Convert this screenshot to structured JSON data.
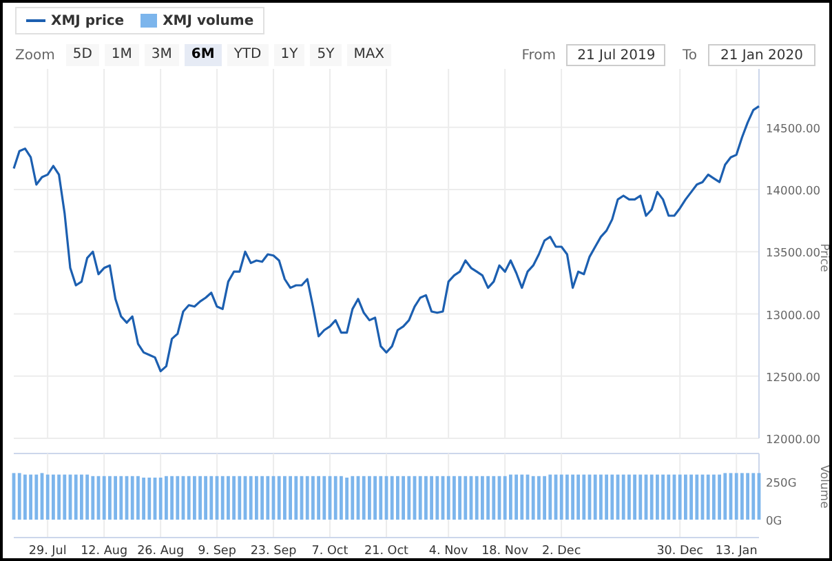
{
  "zoom": {
    "label": "Zoom",
    "buttons": [
      {
        "label": "5D",
        "selected": false
      },
      {
        "label": "1M",
        "selected": false
      },
      {
        "label": "3M",
        "selected": false
      },
      {
        "label": "6M",
        "selected": true
      },
      {
        "label": "YTD",
        "selected": false
      },
      {
        "label": "1Y",
        "selected": false
      },
      {
        "label": "5Y",
        "selected": false
      },
      {
        "label": "MAX",
        "selected": false
      }
    ]
  },
  "range": {
    "from_label": "From",
    "from": "21 Jul 2019",
    "to_label": "To",
    "to": "21 Jan 2020"
  },
  "price_panel": {
    "chart_data": {
      "type": "line",
      "ylabel": "Price",
      "grid": true,
      "ylim": [
        12000,
        14970
      ],
      "yticks": [
        {
          "value": 12000,
          "label": "12000.00"
        },
        {
          "value": 12500,
          "label": "12500.00"
        },
        {
          "value": 13000,
          "label": "13000.00"
        },
        {
          "value": 13500,
          "label": "13500.00"
        },
        {
          "value": 14000,
          "label": "14000.00"
        },
        {
          "value": 14500,
          "label": "14500.00"
        }
      ],
      "categories": [
        null,
        null,
        null,
        null,
        null,
        null,
        null,
        null,
        null,
        null,
        null,
        null,
        null,
        null,
        null,
        null,
        null,
        null,
        null,
        null,
        null,
        null,
        null,
        null,
        null,
        null,
        null,
        null,
        null,
        null,
        null,
        null,
        null,
        null,
        null,
        null,
        null,
        null,
        null,
        null,
        null,
        null,
        null,
        null,
        null,
        null,
        null,
        null,
        null,
        null,
        null,
        null,
        null,
        null,
        null,
        null,
        null,
        null,
        null,
        null,
        null,
        null,
        null,
        null,
        null,
        null,
        null,
        null,
        null,
        null,
        null,
        null,
        null,
        null,
        null,
        null,
        null,
        null,
        null,
        null,
        null,
        null,
        null,
        null,
        null,
        null,
        null,
        null,
        null,
        null,
        null,
        null,
        null,
        null,
        null,
        null,
        null,
        null,
        null,
        null,
        null,
        null,
        null,
        null,
        null,
        null,
        null,
        null,
        null,
        null,
        null,
        null,
        null,
        null,
        null,
        null,
        null,
        null,
        null,
        null,
        null,
        null,
        null,
        null,
        null,
        null,
        null,
        null,
        null,
        null,
        null,
        null,
        null
      ],
      "series": [
        {
          "name": "XMJ price",
          "color": "#1c5fb0",
          "values": [
            14170,
            14310,
            14330,
            14260,
            14040,
            14100,
            14120,
            14190,
            14120,
            13810,
            13370,
            13230,
            13260,
            13450,
            13500,
            13320,
            13370,
            13390,
            13120,
            12980,
            12930,
            12980,
            12760,
            12690,
            12670,
            12650,
            12540,
            12580,
            12800,
            12840,
            13020,
            13070,
            13060,
            13100,
            13130,
            13170,
            13060,
            13040,
            13260,
            13340,
            13340,
            13500,
            13410,
            13430,
            13420,
            13480,
            13470,
            13430,
            13280,
            13210,
            13230,
            13230,
            13280,
            13060,
            12820,
            12870,
            12900,
            12950,
            12850,
            12850,
            13040,
            13120,
            13010,
            12950,
            12970,
            12740,
            12690,
            12740,
            12870,
            12900,
            12950,
            13060,
            13130,
            13150,
            13020,
            13010,
            13020,
            13260,
            13310,
            13340,
            13430,
            13370,
            13340,
            13310,
            13210,
            13260,
            13390,
            13340,
            13430,
            13330,
            13210,
            13340,
            13390,
            13480,
            13590,
            13620,
            13540,
            13540,
            13480,
            13210,
            13340,
            13320,
            13460,
            13540,
            13620,
            13670,
            13760,
            13920,
            13950,
            13920,
            13920,
            13950,
            13790,
            13840,
            13980,
            13920,
            13790,
            13790,
            13850,
            13920,
            13980,
            14040,
            14060,
            14120,
            14090,
            14060,
            14200,
            14260,
            14280,
            14420,
            14540,
            14640,
            14670
          ]
        }
      ]
    }
  },
  "volume_panel": {
    "chart_data": {
      "type": "bar",
      "ylabel": "Volume",
      "grid": true,
      "ylim": [
        0,
        440
      ],
      "yticks": [
        {
          "value": 0,
          "label": "0G"
        },
        {
          "value": 250,
          "label": "250G"
        }
      ],
      "categories": [
        null,
        null,
        null,
        null,
        null,
        null,
        "29. Jul",
        null,
        null,
        null,
        null,
        null,
        null,
        null,
        null,
        null,
        "12. Aug",
        null,
        null,
        null,
        null,
        null,
        null,
        null,
        null,
        null,
        "26. Aug",
        null,
        null,
        null,
        null,
        null,
        null,
        null,
        null,
        null,
        "9. Sep",
        null,
        null,
        null,
        null,
        null,
        null,
        null,
        null,
        null,
        "23. Sep",
        null,
        null,
        null,
        null,
        null,
        null,
        null,
        null,
        null,
        "7. Oct",
        null,
        null,
        null,
        null,
        null,
        null,
        null,
        null,
        null,
        "21. Oct",
        null,
        null,
        null,
        null,
        null,
        null,
        null,
        null,
        null,
        null,
        "4. Nov",
        null,
        null,
        null,
        null,
        null,
        null,
        null,
        null,
        null,
        "18. Nov",
        null,
        null,
        null,
        null,
        null,
        null,
        null,
        null,
        null,
        "2. Dec",
        null,
        null,
        null,
        null,
        null,
        null,
        null,
        null,
        null,
        null,
        null,
        null,
        null,
        null,
        null,
        null,
        null,
        null,
        null,
        null,
        "30. Dec",
        null,
        null,
        null,
        null,
        null,
        null,
        null,
        null,
        null,
        "13. Jan",
        null,
        null,
        null,
        null
      ],
      "series": [
        {
          "name": "XMJ volume",
          "color": "#7cb5ec",
          "values": [
            310,
            310,
            300,
            300,
            300,
            310,
            300,
            300,
            300,
            300,
            300,
            300,
            300,
            300,
            290,
            290,
            290,
            290,
            290,
            290,
            290,
            290,
            290,
            280,
            280,
            280,
            280,
            290,
            290,
            290,
            290,
            290,
            290,
            290,
            290,
            290,
            290,
            290,
            290,
            290,
            290,
            290,
            290,
            290,
            290,
            290,
            290,
            290,
            290,
            290,
            290,
            290,
            290,
            290,
            290,
            290,
            290,
            290,
            290,
            280,
            290,
            290,
            290,
            290,
            290,
            290,
            290,
            290,
            290,
            290,
            290,
            290,
            290,
            290,
            290,
            290,
            290,
            290,
            290,
            290,
            290,
            290,
            290,
            290,
            290,
            290,
            290,
            290,
            300,
            300,
            300,
            300,
            290,
            290,
            290,
            300,
            300,
            300,
            300,
            300,
            300,
            300,
            300,
            300,
            300,
            300,
            300,
            300,
            300,
            300,
            300,
            300,
            300,
            300,
            300,
            300,
            300,
            300,
            300,
            300,
            300,
            300,
            300,
            300,
            300,
            300,
            310,
            310,
            310,
            310,
            310,
            310,
            310
          ]
        }
      ]
    }
  }
}
